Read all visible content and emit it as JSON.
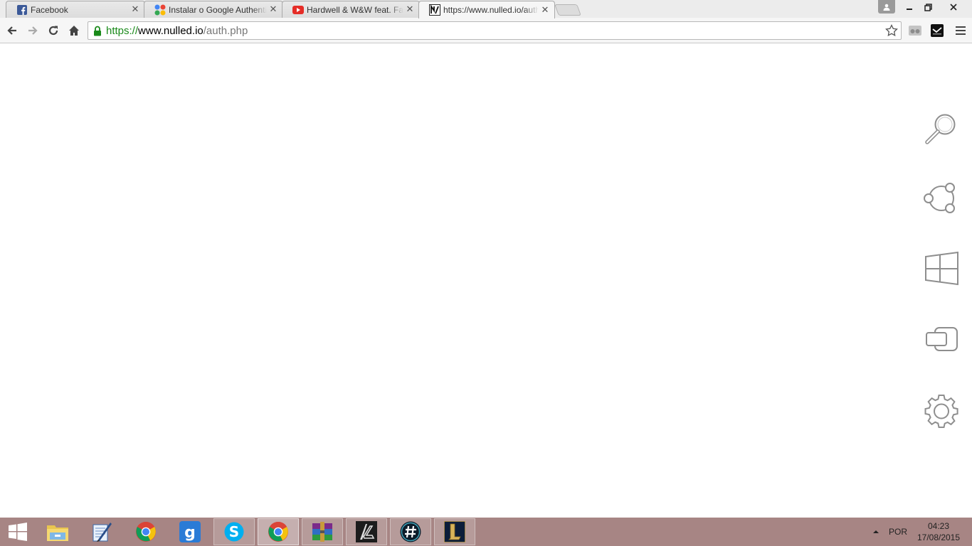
{
  "browser": {
    "tabs": [
      {
        "title": "Facebook",
        "favicon": "facebook-icon"
      },
      {
        "title": "Instalar o Google Authenticator",
        "favicon": "google-icon"
      },
      {
        "title": "Hardwell & W&W feat. Fatman Scoop",
        "favicon": "youtube-icon"
      },
      {
        "title": "https://www.nulled.io/auth.php",
        "favicon": "nulled-icon"
      }
    ],
    "close_glyph": "✕",
    "url": {
      "scheme": "https://",
      "host": "www.nulled.io",
      "path": "/auth.php"
    }
  },
  "side_icons": [
    "search-icon",
    "share-icon",
    "windows-icon",
    "display-icon",
    "gear-icon"
  ],
  "taskbar": {
    "apps": [
      "start-icon",
      "file-explorer-icon",
      "notepad-icon",
      "chrome-icon",
      "garena-icon",
      "skype-icon",
      "chrome-icon",
      "winrar-icon",
      "lol-replay-icon",
      "hashtag-icon",
      "league-of-legends-icon"
    ],
    "language": "POR",
    "time": "04:23",
    "date": "17/08/2015"
  },
  "colors": {
    "taskbar": "#a78584",
    "secure": "#1a8a1a"
  }
}
